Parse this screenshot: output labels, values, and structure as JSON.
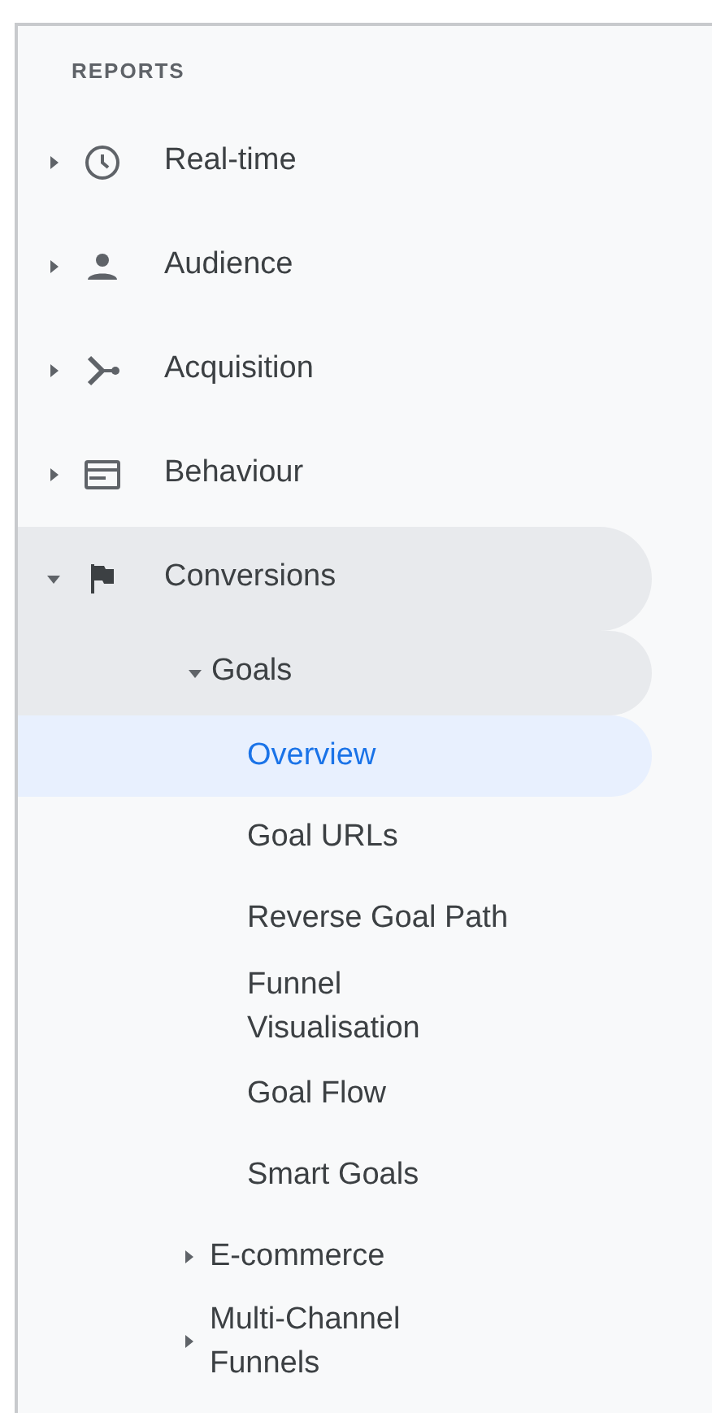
{
  "section_title": "REPORTS",
  "items": [
    {
      "label": "Real-time",
      "expanded": false
    },
    {
      "label": "Audience",
      "expanded": false
    },
    {
      "label": "Acquisition",
      "expanded": false
    },
    {
      "label": "Behaviour",
      "expanded": false
    },
    {
      "label": "Conversions",
      "expanded": true,
      "children": [
        {
          "label": "Goals",
          "expanded": true,
          "children": [
            {
              "label": "Overview",
              "selected": true
            },
            {
              "label": "Goal URLs",
              "selected": false
            },
            {
              "label": "Reverse Goal Path",
              "selected": false
            },
            {
              "label": "Funnel Visualisation",
              "selected": false
            },
            {
              "label": "Goal Flow",
              "selected": false
            },
            {
              "label": "Smart Goals",
              "selected": false
            }
          ]
        },
        {
          "label": "E-commerce",
          "expanded": false
        },
        {
          "label": "Multi-Channel Funnels",
          "expanded": false
        }
      ]
    }
  ]
}
